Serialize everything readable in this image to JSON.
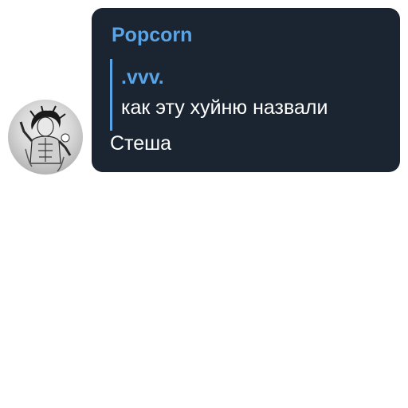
{
  "message": {
    "sender": "Popcorn",
    "reply_author": ".vvv.",
    "reply_text": "как эту хуйню назвали",
    "text": "Стеша"
  },
  "avatar": {
    "icon": "manga-character-avatar"
  },
  "colors": {
    "bubble_background": "#1b2431",
    "accent": "#5aa4e6",
    "text": "#ffffff",
    "page_background": "#ffffff"
  }
}
